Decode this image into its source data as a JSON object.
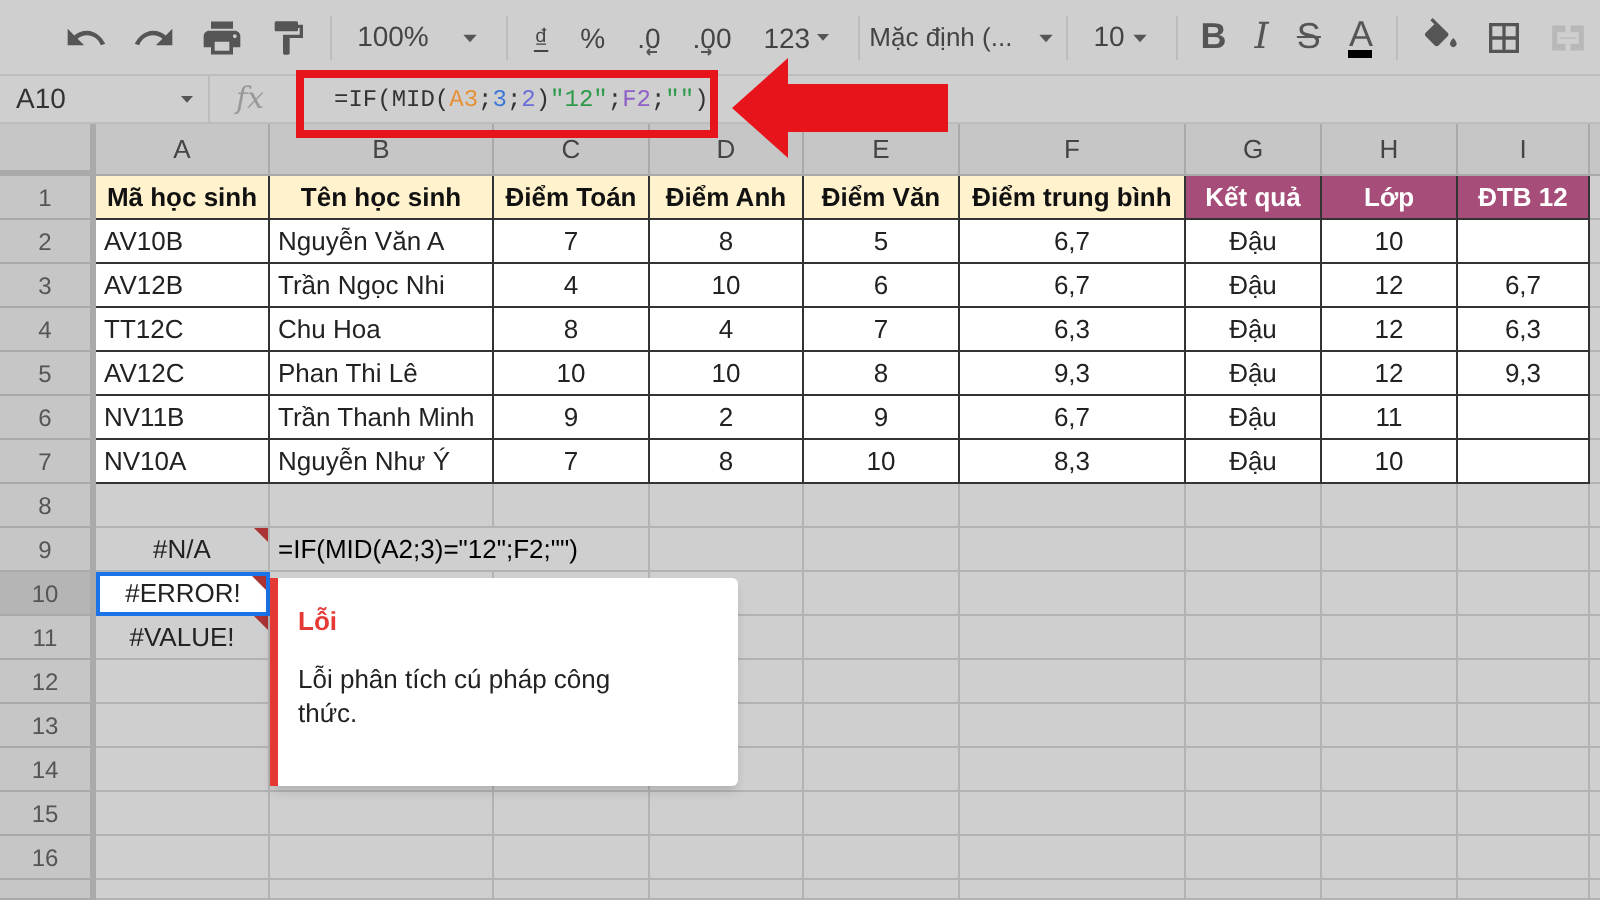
{
  "toolbar": {
    "zoom": "100%",
    "number_formats": [
      "₫",
      "%",
      ".0",
      ".00",
      "123"
    ],
    "font": "Mặc định (...",
    "font_size": "10",
    "text_styles": [
      "B",
      "I",
      "S",
      "A"
    ]
  },
  "formula_bar": {
    "cell_ref": "A10",
    "fx": "fx",
    "tokens": [
      {
        "text": "=IF(MID(",
        "color": "#333333"
      },
      {
        "text": "A3",
        "color": "#e69138"
      },
      {
        "text": ";",
        "color": "#333333"
      },
      {
        "text": "3",
        "color": "#3d78d8"
      },
      {
        "text": ";",
        "color": "#333333"
      },
      {
        "text": "2",
        "color": "#6f6fd8"
      },
      {
        "text": ")",
        "color": "#333333"
      },
      {
        "text": "\"12\"",
        "color": "#2e9a4a"
      },
      {
        "text": ";",
        "color": "#333333"
      },
      {
        "text": "F2",
        "color": "#8e5fc7"
      },
      {
        "text": ";",
        "color": "#333333"
      },
      {
        "text": "\"\"",
        "color": "#2e9a4a"
      },
      {
        "text": ")",
        "color": "#333333"
      }
    ]
  },
  "columns": [
    "A",
    "B",
    "C",
    "D",
    "E",
    "F",
    "G",
    "H",
    "I"
  ],
  "row_numbers": [
    {
      "label": "1",
      "selected": false
    },
    {
      "label": "2",
      "selected": false
    },
    {
      "label": "3",
      "selected": false
    },
    {
      "label": "4",
      "selected": false
    },
    {
      "label": "5",
      "selected": false
    },
    {
      "label": "6",
      "selected": false
    },
    {
      "label": "7",
      "selected": false
    },
    {
      "label": "8",
      "selected": false
    },
    {
      "label": "9",
      "selected": false
    },
    {
      "label": "10",
      "selected": true
    },
    {
      "label": "11",
      "selected": false
    },
    {
      "label": "12",
      "selected": false
    },
    {
      "label": "13",
      "selected": false
    },
    {
      "label": "14",
      "selected": false
    },
    {
      "label": "15",
      "selected": false
    },
    {
      "label": "16",
      "selected": false
    }
  ],
  "table": {
    "headers": [
      {
        "label": "Mã học sinh",
        "color": "#fff2cc"
      },
      {
        "label": "Tên học sinh",
        "color": "#fff2cc"
      },
      {
        "label": "Điểm Toán",
        "color": "#fff2cc"
      },
      {
        "label": "Điểm Anh",
        "color": "#fff2cc"
      },
      {
        "label": "Điểm Văn",
        "color": "#fff2cc"
      },
      {
        "label": "Điểm trung bình",
        "color": "#fff2cc"
      },
      {
        "label": "Kết quả",
        "color": "#a64d79"
      },
      {
        "label": "Lớp",
        "color": "#a64d79"
      },
      {
        "label": "ĐTB 12",
        "color": "#a64d79"
      }
    ],
    "rows": [
      [
        "AV10B",
        "Nguyễn Văn A",
        "7",
        "8",
        "5",
        "6,7",
        "Đậu",
        "10",
        ""
      ],
      [
        "AV12B",
        "Trần Ngọc Nhi",
        "4",
        "10",
        "6",
        "6,7",
        "Đậu",
        "12",
        "6,7"
      ],
      [
        "TT12C",
        "Chu Hoa",
        "8",
        "4",
        "7",
        "6,3",
        "Đậu",
        "12",
        "6,3"
      ],
      [
        "AV12C",
        "Phan Thi Lê",
        "10",
        "10",
        "8",
        "9,3",
        "Đậu",
        "12",
        "9,3"
      ],
      [
        "NV11B",
        "Trần Thanh Minh",
        "9",
        "2",
        "9",
        "6,7",
        "Đậu",
        "11",
        ""
      ],
      [
        "NV10A",
        "Nguyễn Như Ý",
        "7",
        "8",
        "10",
        "8,3",
        "Đậu",
        "10",
        ""
      ]
    ]
  },
  "error_cells": [
    {
      "value": "#N/A",
      "error": true,
      "selected": false,
      "note": "=IF(MID(A2;3)=\"12\";F2;\"\")"
    },
    {
      "value": "#ERROR!",
      "error": true,
      "selected": true
    },
    {
      "value": "#VALUE!",
      "error": true,
      "selected": false
    }
  ],
  "error_popup": {
    "title": "Lỗi",
    "message": "Lỗi phân tích cú pháp công thức."
  }
}
